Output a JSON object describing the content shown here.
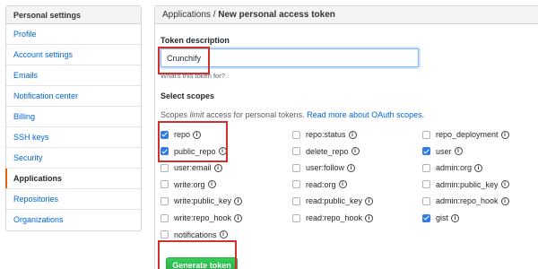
{
  "sidebar": {
    "header": "Personal settings",
    "items": [
      {
        "label": "Profile",
        "active": false
      },
      {
        "label": "Account settings",
        "active": false
      },
      {
        "label": "Emails",
        "active": false
      },
      {
        "label": "Notification center",
        "active": false
      },
      {
        "label": "Billing",
        "active": false
      },
      {
        "label": "SSH keys",
        "active": false
      },
      {
        "label": "Security",
        "active": false
      },
      {
        "label": "Applications",
        "active": true
      },
      {
        "label": "Repositories",
        "active": false
      },
      {
        "label": "Organizations",
        "active": false
      }
    ]
  },
  "main": {
    "breadcrumb_parent": "Applications",
    "breadcrumb_sep": " / ",
    "breadcrumb_current": "New personal access token",
    "token_label": "Token description",
    "token_value": "Crunchify",
    "token_note": "What's this token for?",
    "scopes_label": "Select scopes",
    "scopes_desc_prefix": "Scopes ",
    "scopes_desc_em": "limit",
    "scopes_desc_suffix": " access for personal tokens. ",
    "scopes_link": "Read more about OAuth scopes.",
    "generate_button": "Generate token"
  },
  "scopes": {
    "col1": [
      {
        "label": "repo",
        "checked": true
      },
      {
        "label": "public_repo",
        "checked": true
      },
      {
        "label": "user:email",
        "checked": false
      },
      {
        "label": "write:org",
        "checked": false
      },
      {
        "label": "write:public_key",
        "checked": false
      },
      {
        "label": "write:repo_hook",
        "checked": false
      },
      {
        "label": "notifications",
        "checked": false
      }
    ],
    "col2": [
      {
        "label": "repo:status",
        "checked": false
      },
      {
        "label": "delete_repo",
        "checked": false
      },
      {
        "label": "user:follow",
        "checked": false
      },
      {
        "label": "read:org",
        "checked": false
      },
      {
        "label": "read:public_key",
        "checked": false
      },
      {
        "label": "read:repo_hook",
        "checked": false
      }
    ],
    "col3": [
      {
        "label": "repo_deployment",
        "checked": false
      },
      {
        "label": "user",
        "checked": true
      },
      {
        "label": "admin:org",
        "checked": false
      },
      {
        "label": "admin:public_key",
        "checked": false
      },
      {
        "label": "admin:repo_hook",
        "checked": false
      },
      {
        "label": "gist",
        "checked": true
      }
    ]
  },
  "icons": {
    "info": "info-circle-icon",
    "checkbox": "checkbox-icon"
  },
  "colors": {
    "link": "#0366d6",
    "checked": "#2f7ae5",
    "button": "#28a745",
    "highlight": "#d0312d",
    "active_marker": "#e36209"
  }
}
